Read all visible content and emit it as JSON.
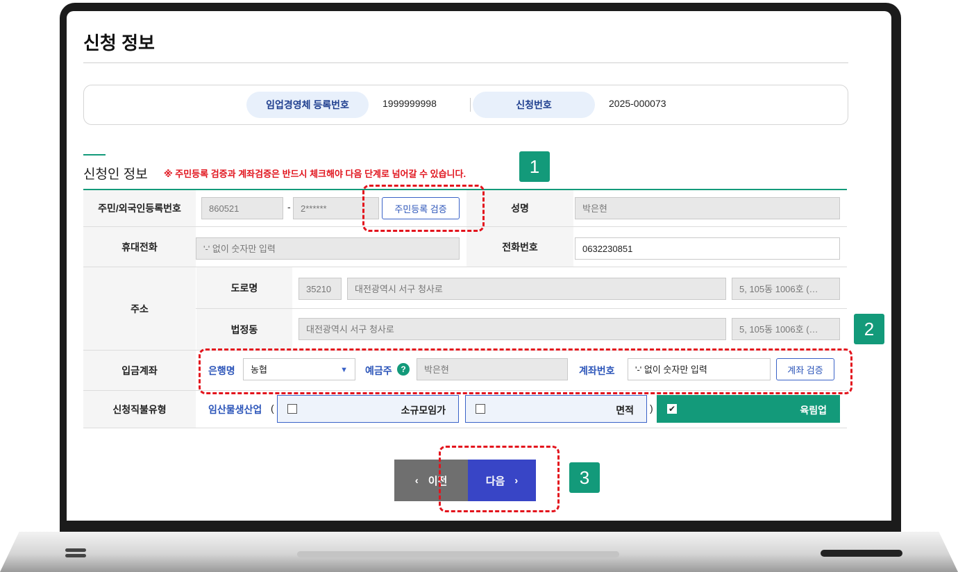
{
  "page": {
    "title": "신청 정보"
  },
  "summary": {
    "reg_label": "임업경영체 등록번호",
    "reg_value": "1999999998",
    "app_label": "신청번호",
    "app_value": "2025-000073"
  },
  "section": {
    "title": "신청인 정보",
    "warning": "※ 주민등록 검증과 계좌검증은 반드시 체크해야 다음 단계로 넘어갈 수 있습니다."
  },
  "form": {
    "resident": {
      "label": "주민/외국인등록번호",
      "front": "860521",
      "dash": "-",
      "back": "2******",
      "verify_button": "주민등록 검증"
    },
    "name": {
      "label": "성명",
      "value": "박은현"
    },
    "mobile": {
      "label": "휴대전화",
      "placeholder": "'-' 없이 숫자만 입력"
    },
    "phone": {
      "label": "전화번호",
      "value": "0632230851"
    },
    "address": {
      "label": "주소",
      "road_label": "도로명",
      "zip": "35210",
      "road": "대전광역시 서구 청사로",
      "road_detail": "5, 105동 1006호 (…",
      "lot_label": "법정동",
      "lot": "대전광역시 서구 청사로",
      "lot_detail": "5, 105동 1006호 (…"
    },
    "account": {
      "label": "입금계좌",
      "bank_label": "은행명",
      "bank_value": "농협",
      "holder_label": "예금주",
      "holder_help": "?",
      "holder_value": "박은현",
      "number_label": "계좌번호",
      "number_placeholder": "'-' 없이 숫자만 입력",
      "verify_button": "계좌 검증"
    },
    "payment_type": {
      "label": "신청직불유형",
      "category": "임산물생산업",
      "paren_open": "(",
      "paren_close": ")",
      "options": [
        {
          "label": "소규모임가",
          "checked": false
        },
        {
          "label": "면적",
          "checked": false
        },
        {
          "label": "육림업",
          "checked": true
        }
      ],
      "check_mark": "✔"
    }
  },
  "nav": {
    "prev": "이전",
    "next": "다음",
    "prev_icon": "‹",
    "next_icon": "›"
  },
  "callouts": [
    "1",
    "2",
    "3"
  ],
  "colors": {
    "accent": "#139a7a",
    "primary": "#3845c6",
    "warning": "#e1141d"
  }
}
